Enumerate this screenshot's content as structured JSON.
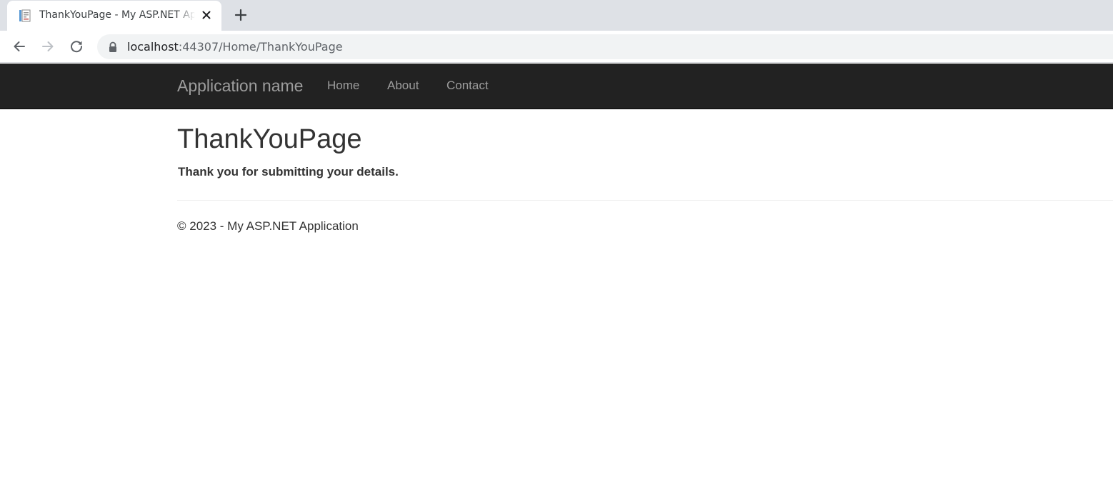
{
  "browser": {
    "tab": {
      "title": "ThankYouPage - My ASP.NET Application",
      "favicon": "document-icon"
    },
    "address_bar": {
      "host": "localhost",
      "path": ":44307/Home/ThankYouPage"
    }
  },
  "navbar": {
    "brand": "Application name",
    "links": [
      "Home",
      "About",
      "Contact"
    ],
    "background": "#222222",
    "link_color": "#9d9d9d"
  },
  "main": {
    "title": "ThankYouPage",
    "message": "Thank you for submitting your details."
  },
  "footer": {
    "text": "© 2023 - My ASP.NET Application"
  }
}
